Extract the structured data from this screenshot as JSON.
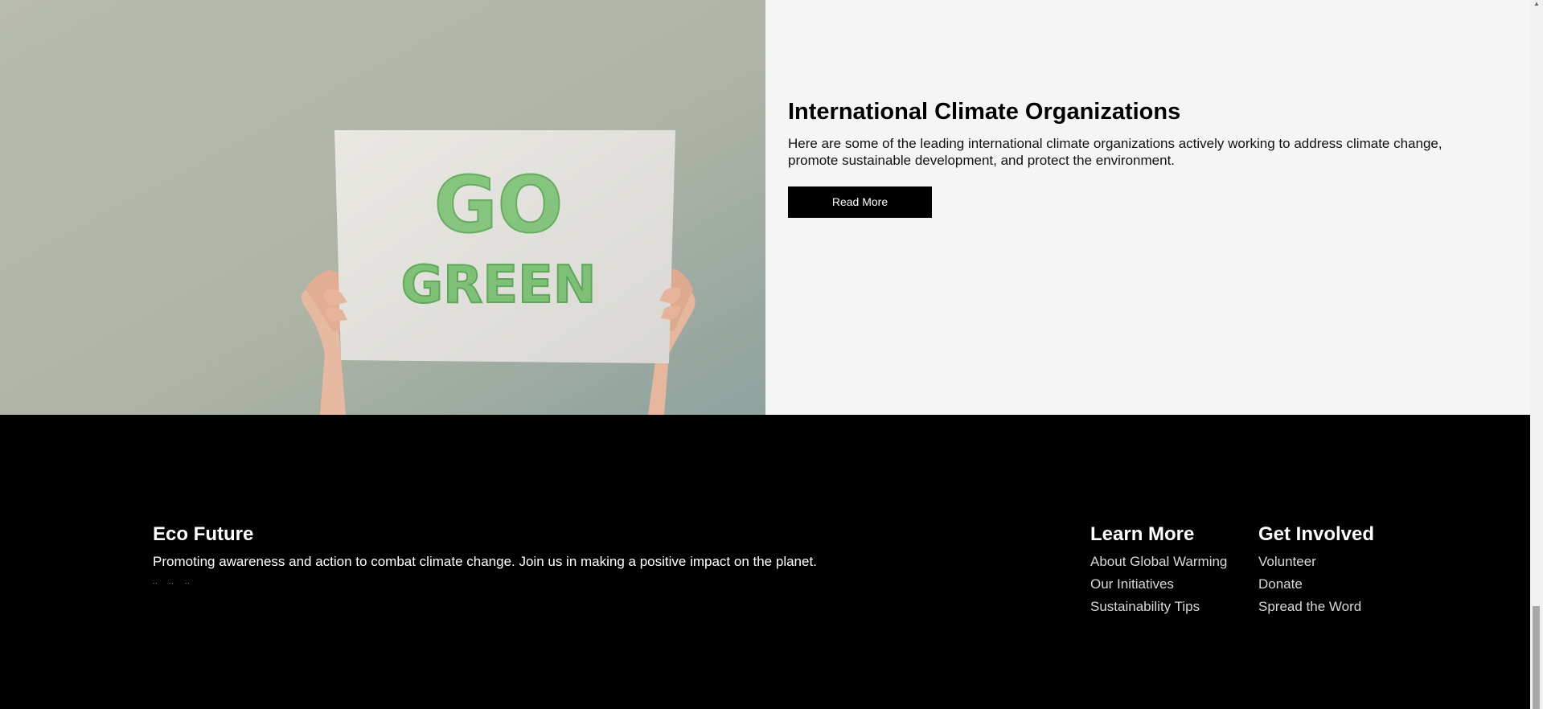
{
  "feature": {
    "image_alt": "Hands holding a sign reading GO GREEN",
    "sign_line1": "GO",
    "sign_line2": "GREEN",
    "title": "International Climate Organizations",
    "text": "Here are some of the leading international climate organizations actively working to address climate change, promote sustainable development, and protect the environment.",
    "button_label": "Read More"
  },
  "footer": {
    "brand": {
      "title": "Eco Future",
      "text": "Promoting awareness and action to combat climate change. Join us in making a positive impact on the planet.",
      "social_icons": [
        "facebook-icon",
        "twitter-icon",
        "instagram-icon"
      ],
      "social_glyph": ".."
    },
    "learn_more": {
      "title": "Learn More",
      "items": [
        "About Global Warming",
        "Our Initiatives",
        "Sustainability Tips"
      ]
    },
    "get_involved": {
      "title": "Get Involved",
      "items": [
        "Volunteer",
        "Donate",
        "Spread the Word"
      ]
    }
  },
  "scrollbar": {
    "up_arrow_glyph": "▲"
  },
  "colors": {
    "page_bg": "#f5f5f5",
    "footer_bg": "#000000",
    "button_bg": "#000000",
    "sign_green": "#6fbf6a"
  }
}
